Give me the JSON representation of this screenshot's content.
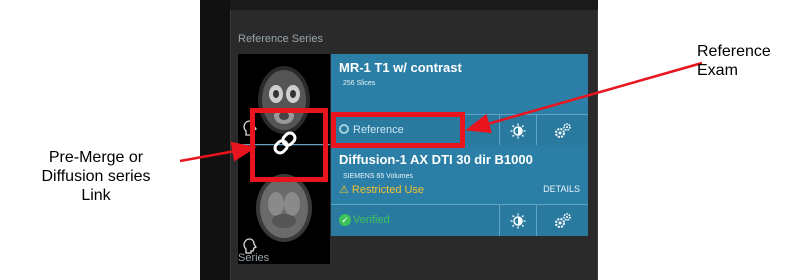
{
  "panel": {
    "reference_series_title": "Reference Series",
    "series_title": "Series"
  },
  "reference_exam": {
    "title": "MR-1 T1 w/ contrast",
    "subtitle": "256 Slices",
    "status_label": "Reference",
    "status_icon": "circle-outline-icon",
    "brightness_icon": "brightness-icon",
    "settings_icon": "gears-icon"
  },
  "linked_series": {
    "title": "Diffusion-1 AX DTI 30 dir B1000",
    "subtitle": "SIEMENS 65 Volumes",
    "warning_label": "⚠ Restricted Use",
    "details_label": "DETAILS",
    "status_label": "Verified",
    "status_icon": "check-circle-icon",
    "brightness_icon": "brightness-icon",
    "settings_icon": "gears-icon"
  },
  "annotations": {
    "left_label": "Pre-Merge or\nDiffusion series\nLink",
    "right_label": "Reference\nExam"
  },
  "colors": {
    "card_blue": "#2b7fa6",
    "highlight_red": "#e8141e",
    "warning_yellow": "#f2c230",
    "verified_green": "#3cc25a"
  }
}
